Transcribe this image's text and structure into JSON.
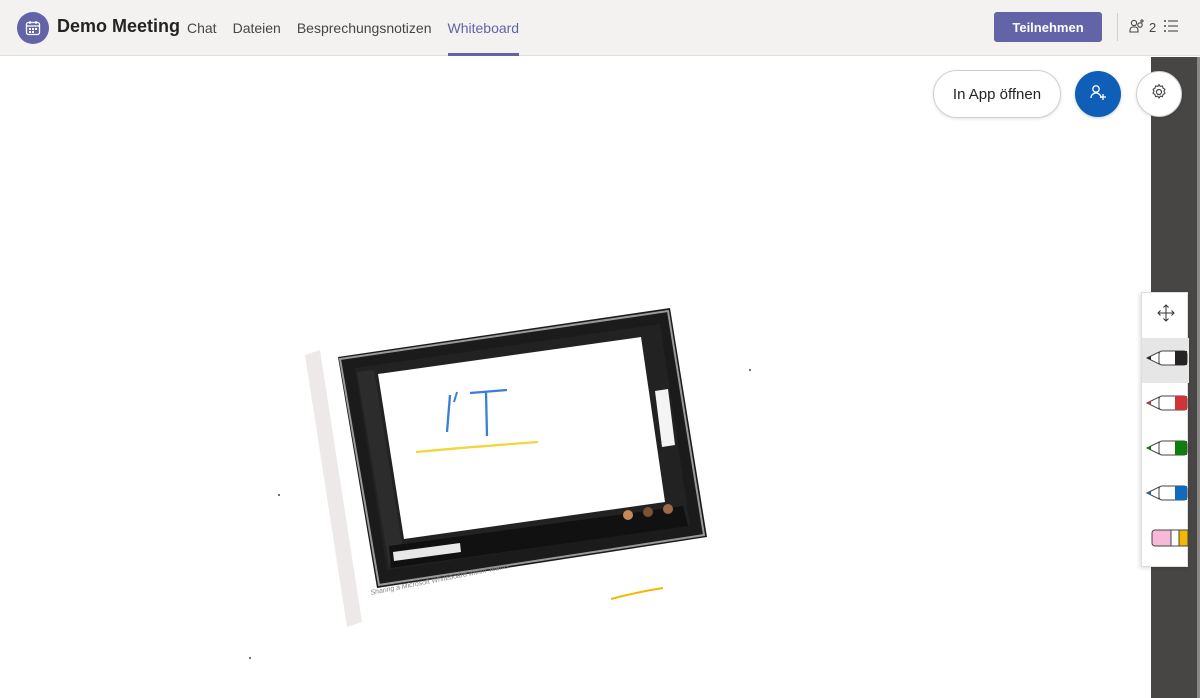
{
  "header": {
    "title": "Demo Meeting",
    "tabs": [
      {
        "label": "Chat",
        "active": false
      },
      {
        "label": "Dateien",
        "active": false
      },
      {
        "label": "Besprechungsnotizen",
        "active": false
      },
      {
        "label": "Whiteboard",
        "active": true
      }
    ],
    "join_label": "Teilnehmen",
    "participant_count": "2",
    "icons": [
      "calendar-icon",
      "participants-icon",
      "list-icon"
    ]
  },
  "whiteboard": {
    "open_in_app_label": "In App öffnen",
    "icons": [
      "add-person-icon",
      "gear-icon"
    ],
    "caption": "Sharing a Microsoft Whiteboard within Teams",
    "board_text": "I'T"
  },
  "toolbar": {
    "tools": [
      {
        "name": "pan",
        "icon": "move-icon",
        "active": false
      },
      {
        "name": "black-pen",
        "icon": "pen-icon",
        "color": "#252423",
        "active": true
      },
      {
        "name": "red-pen",
        "icon": "pen-icon",
        "color": "#d13438",
        "active": false
      },
      {
        "name": "green-pen",
        "icon": "pen-icon",
        "color": "#107c10",
        "active": false
      },
      {
        "name": "blue-pen",
        "icon": "pen-icon",
        "color": "#0f6cbd",
        "active": false
      },
      {
        "name": "eraser",
        "icon": "eraser-icon",
        "color": "#f7b9d6",
        "active": false
      }
    ]
  },
  "colors": {
    "brand": "#6264a7",
    "invite": "#0f5fb8"
  }
}
